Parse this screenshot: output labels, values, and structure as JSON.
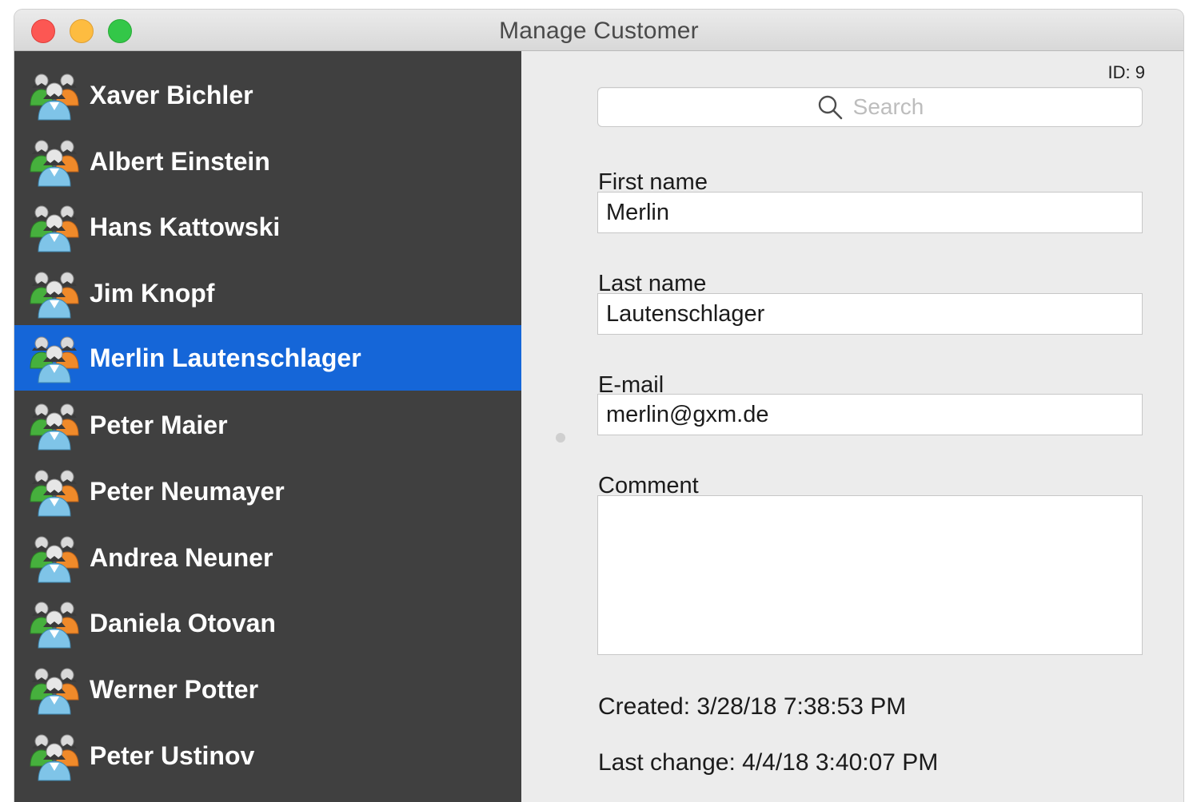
{
  "window": {
    "title": "Manage Customer"
  },
  "icons": {
    "customer": "user-group-icon",
    "search": "magnifier-icon"
  },
  "colors": {
    "sidebar_bg": "#404040",
    "selected_bg": "#1566d8",
    "content_bg": "#ececec",
    "close": "#fc5753",
    "minimize": "#fdbc40",
    "zoom": "#33c748"
  },
  "sidebar": {
    "items": [
      {
        "label": "Xaver Bichler"
      },
      {
        "label": "Albert Einstein"
      },
      {
        "label": "Hans Kattowski"
      },
      {
        "label": "Jim Knopf"
      },
      {
        "label": "Merlin Lautenschlager",
        "selected": true
      },
      {
        "label": "Peter Maier"
      },
      {
        "label": "Peter Neumayer"
      },
      {
        "label": "Andrea Neuner"
      },
      {
        "label": "Daniela Otovan"
      },
      {
        "label": "Werner Potter"
      },
      {
        "label": "Peter Ustinov"
      }
    ]
  },
  "detail": {
    "id_label": "ID: 9",
    "search": {
      "placeholder": "Search",
      "value": ""
    },
    "first_name": {
      "label": "First name",
      "value": "Merlin"
    },
    "last_name": {
      "label": "Last name",
      "value": "Lautenschlager"
    },
    "email": {
      "label": "E-mail",
      "value": "merlin@gxm.de"
    },
    "comment": {
      "label": "Comment",
      "value": ""
    },
    "created": "Created: 3/28/18 7:38:53 PM",
    "last_change": "Last change: 4/4/18 3:40:07 PM"
  }
}
